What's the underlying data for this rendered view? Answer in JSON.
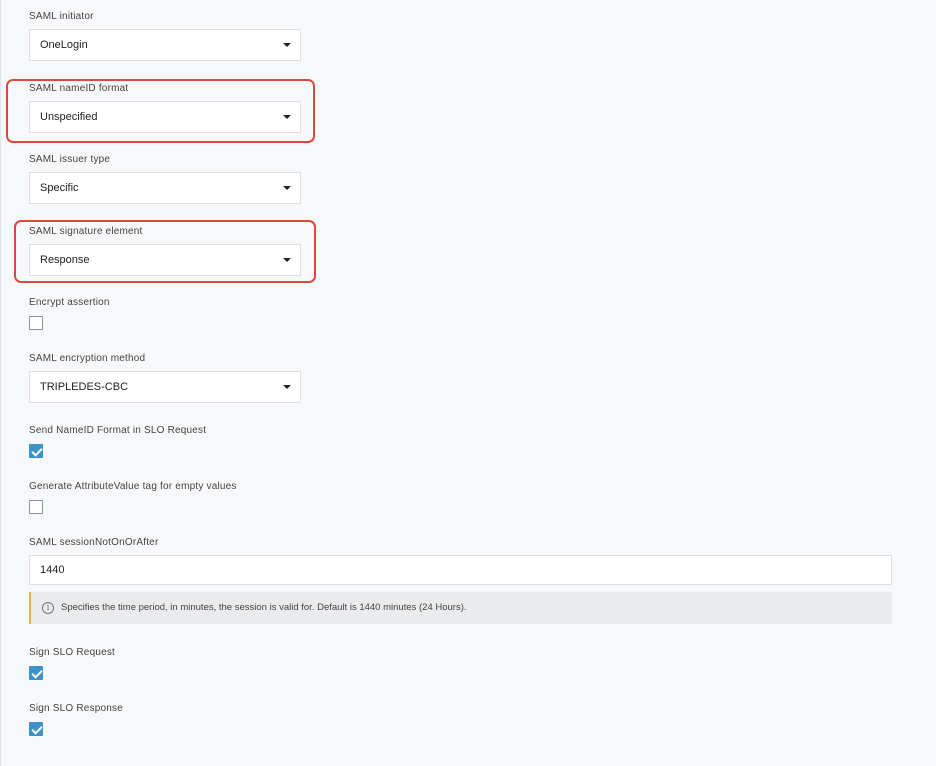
{
  "fields": {
    "saml_initiator": {
      "label": "SAML initiator",
      "value": "OneLogin"
    },
    "nameid_format": {
      "label": "SAML nameID format",
      "value": "Unspecified"
    },
    "issuer_type": {
      "label": "SAML issuer type",
      "value": "Specific"
    },
    "signature_element": {
      "label": "SAML signature element",
      "value": "Response"
    },
    "encrypt_assertion": {
      "label": "Encrypt assertion",
      "checked": false
    },
    "encryption_method": {
      "label": "SAML encryption method",
      "value": "TRIPLEDES-CBC"
    },
    "send_nameid_format": {
      "label": "Send NameID Format in SLO Request",
      "checked": true
    },
    "generate_attributevalue": {
      "label": "Generate AttributeValue tag for empty values",
      "checked": false
    },
    "session_not_on_or_after": {
      "label": "SAML sessionNotOnOrAfter",
      "value": "1440",
      "hint": "Specifies the time period, in minutes, the session is valid for. Default is 1440 minutes (24 Hours)."
    },
    "sign_slo_request": {
      "label": "Sign SLO Request",
      "checked": true
    },
    "sign_slo_response": {
      "label": "Sign SLO Response",
      "checked": true
    }
  },
  "icons": {
    "dropdown": "caret-down-icon",
    "info": "info-circle-icon",
    "info_glyph": "i"
  },
  "colors": {
    "highlight": "#e0473c",
    "checkbox_checked": "#3c93c9",
    "hint_accent": "#e8b04d"
  }
}
